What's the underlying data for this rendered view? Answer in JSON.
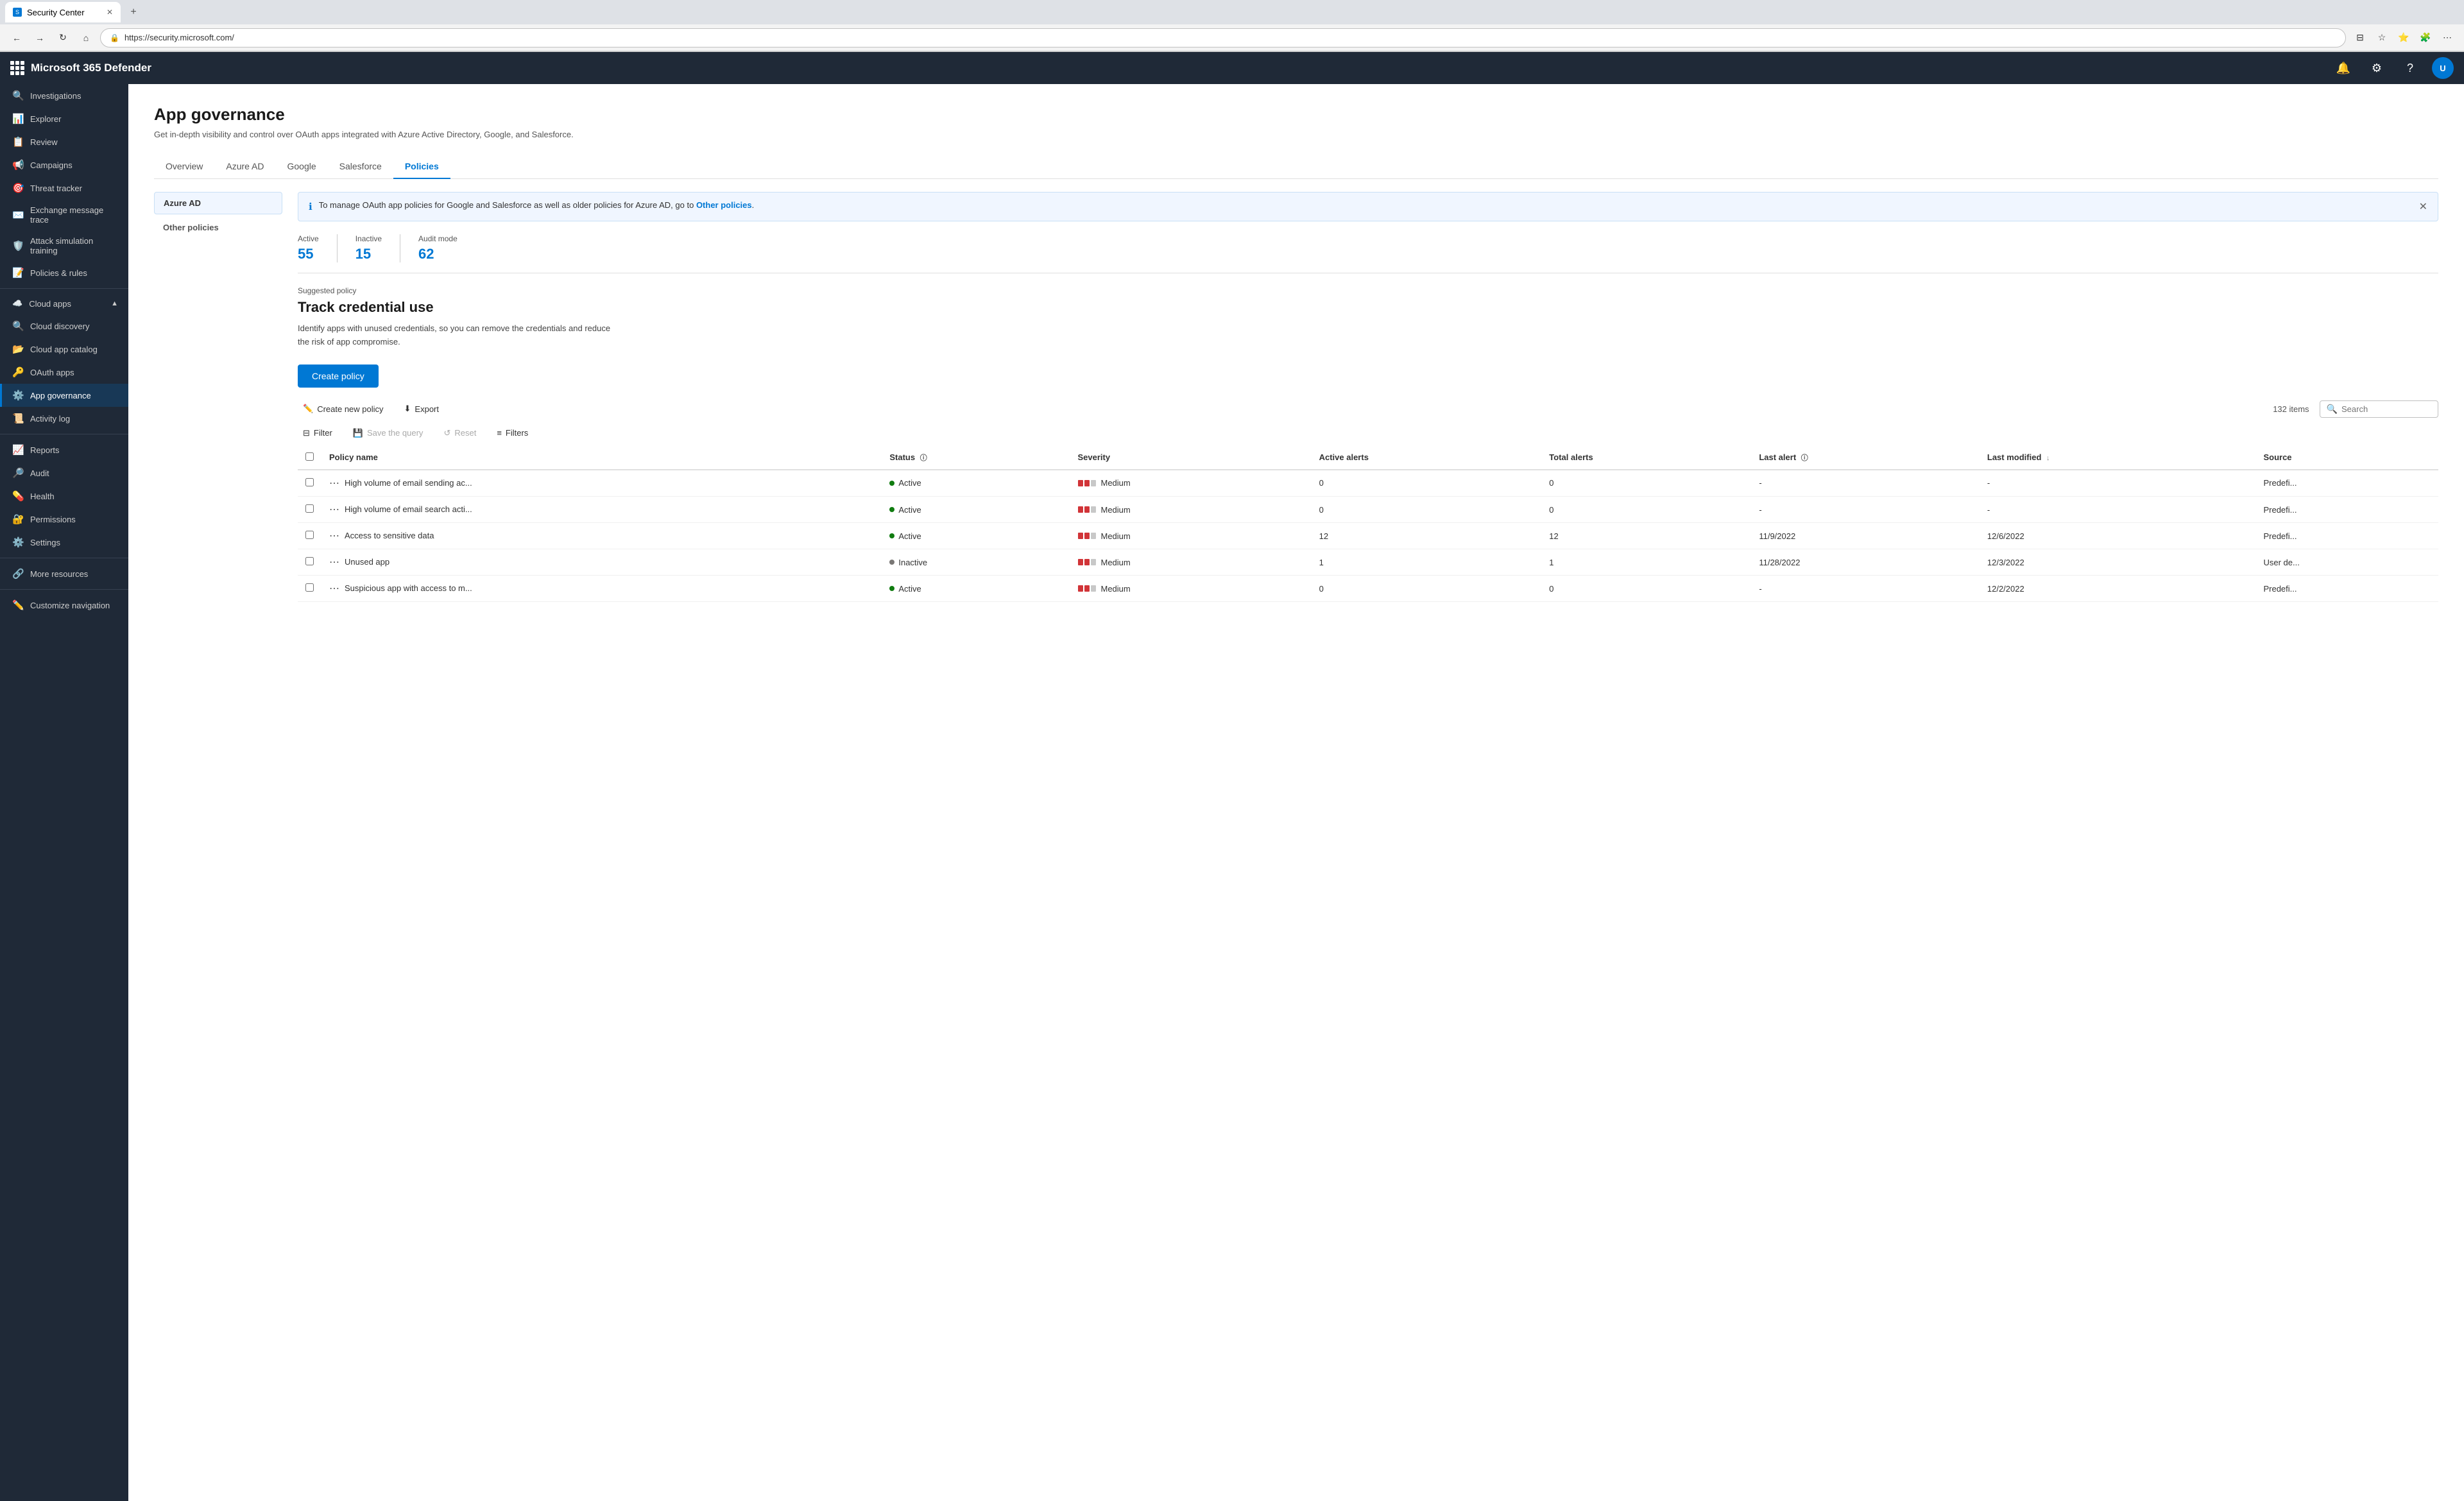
{
  "browser": {
    "tab_favicon": "S",
    "tab_title": "Security Center",
    "address": "https://security.microsoft.com/"
  },
  "topbar": {
    "app_name": "Microsoft 365 Defender",
    "avatar_initials": "U"
  },
  "sidebar": {
    "items": [
      {
        "id": "investigations",
        "label": "Investigations",
        "icon": "🔍",
        "active": false
      },
      {
        "id": "explorer",
        "label": "Explorer",
        "icon": "📊",
        "active": false
      },
      {
        "id": "review",
        "label": "Review",
        "icon": "📋",
        "active": false
      },
      {
        "id": "campaigns",
        "label": "Campaigns",
        "icon": "📢",
        "active": false
      },
      {
        "id": "threat-tracker",
        "label": "Threat tracker",
        "icon": "🎯",
        "active": false
      },
      {
        "id": "exchange",
        "label": "Exchange message trace",
        "icon": "✉️",
        "active": false
      },
      {
        "id": "attack-sim",
        "label": "Attack simulation training",
        "icon": "🛡️",
        "active": false
      },
      {
        "id": "policies",
        "label": "Policies & rules",
        "icon": "📝",
        "active": false
      }
    ],
    "cloud_apps_section": {
      "label": "Cloud apps",
      "items": [
        {
          "id": "cloud-discovery",
          "label": "Cloud discovery",
          "icon": "☁️",
          "active": false
        },
        {
          "id": "cloud-app-catalog",
          "label": "Cloud app catalog",
          "icon": "📂",
          "active": false
        },
        {
          "id": "oauth-apps",
          "label": "OAuth apps",
          "icon": "🔑",
          "active": false
        },
        {
          "id": "app-governance",
          "label": "App governance",
          "icon": "⚙️",
          "active": true
        },
        {
          "id": "activity-log",
          "label": "Activity log",
          "icon": "📜",
          "active": false
        }
      ]
    },
    "bottom_items": [
      {
        "id": "reports",
        "label": "Reports",
        "icon": "📈",
        "active": false
      },
      {
        "id": "audit",
        "label": "Audit",
        "icon": "🔎",
        "active": false
      },
      {
        "id": "health",
        "label": "Health",
        "icon": "💊",
        "active": false
      },
      {
        "id": "permissions",
        "label": "Permissions",
        "icon": "🔐",
        "active": false
      },
      {
        "id": "settings",
        "label": "Settings",
        "icon": "⚙️",
        "active": false
      },
      {
        "id": "more-resources",
        "label": "More resources",
        "icon": "🔗",
        "active": false
      },
      {
        "id": "customize",
        "label": "Customize navigation",
        "icon": "✏️",
        "active": false
      }
    ]
  },
  "page": {
    "title": "App governance",
    "description": "Get in-depth visibility and control over OAuth apps integrated with Azure Active Directory, Google, and Salesforce.",
    "tabs": [
      {
        "id": "overview",
        "label": "Overview",
        "active": false
      },
      {
        "id": "azure-ad",
        "label": "Azure AD",
        "active": false
      },
      {
        "id": "google",
        "label": "Google",
        "active": false
      },
      {
        "id": "salesforce",
        "label": "Salesforce",
        "active": false
      },
      {
        "id": "policies",
        "label": "Policies",
        "active": true
      }
    ]
  },
  "policy_nav": [
    {
      "id": "azure-ad",
      "label": "Azure AD",
      "primary": true
    },
    {
      "id": "other-policies",
      "label": "Other policies",
      "primary": false
    }
  ],
  "info_banner": {
    "text": "To manage OAuth app policies for Google and Salesforce as well as older policies for Azure AD, go to",
    "link_text": "Other policies",
    "link": "#"
  },
  "stats": [
    {
      "label": "Active",
      "value": "55"
    },
    {
      "label": "Inactive",
      "value": "15"
    },
    {
      "label": "Audit mode",
      "value": "62"
    }
  ],
  "suggested_policy": {
    "label": "Suggested policy",
    "title": "Track credential use",
    "description": "Identify apps with unused credentials, so you can remove the credentials and reduce\nthe risk of app compromise."
  },
  "toolbar": {
    "create_policy_label": "Create policy",
    "create_new_label": "Create new policy",
    "export_label": "Export",
    "filter_label": "Filter",
    "save_query_label": "Save the query",
    "reset_label": "Reset",
    "filters_label": "Filters",
    "items_count": "132 items",
    "search_placeholder": "Search"
  },
  "table": {
    "columns": [
      {
        "id": "policy-name",
        "label": "Policy name"
      },
      {
        "id": "status",
        "label": "Status",
        "info": true
      },
      {
        "id": "severity",
        "label": "Severity"
      },
      {
        "id": "active-alerts",
        "label": "Active alerts"
      },
      {
        "id": "total-alerts",
        "label": "Total alerts"
      },
      {
        "id": "last-alert",
        "label": "Last alert",
        "info": true
      },
      {
        "id": "last-modified",
        "label": "Last modified",
        "sort": true
      },
      {
        "id": "source",
        "label": "Source"
      }
    ],
    "rows": [
      {
        "name": "High volume of email sending ac...",
        "status": "Active",
        "status_type": "active",
        "severity": "Medium",
        "severity_bars": 2,
        "active_alerts": "0",
        "total_alerts": "0",
        "last_alert": "-",
        "last_modified": "-",
        "source": "Predefi..."
      },
      {
        "name": "High volume of email search acti...",
        "status": "Active",
        "status_type": "active",
        "severity": "Medium",
        "severity_bars": 2,
        "active_alerts": "0",
        "total_alerts": "0",
        "last_alert": "-",
        "last_modified": "-",
        "source": "Predefi..."
      },
      {
        "name": "Access to sensitive data",
        "status": "Active",
        "status_type": "active",
        "severity": "Medium",
        "severity_bars": 2,
        "active_alerts": "12",
        "total_alerts": "12",
        "last_alert": "11/9/2022",
        "last_modified": "12/6/2022",
        "source": "Predefi..."
      },
      {
        "name": "Unused app",
        "status": "Inactive",
        "status_type": "inactive",
        "severity": "Medium",
        "severity_bars": 2,
        "active_alerts": "1",
        "total_alerts": "1",
        "last_alert": "11/28/2022",
        "last_modified": "12/3/2022",
        "source": "User de..."
      },
      {
        "name": "Suspicious app with access to m...",
        "status": "Active",
        "status_type": "active",
        "severity": "Medium",
        "severity_bars": 2,
        "active_alerts": "0",
        "total_alerts": "0",
        "last_alert": "",
        "last_modified": "12/2/2022",
        "source": "Predefi..."
      }
    ]
  }
}
